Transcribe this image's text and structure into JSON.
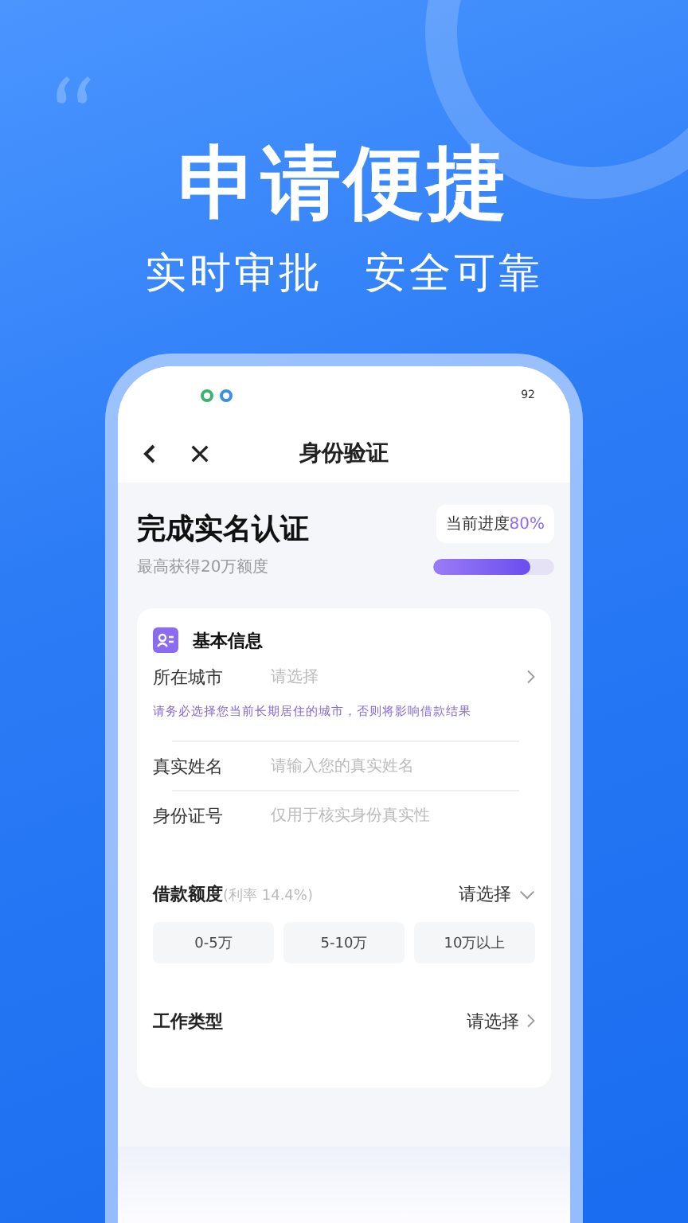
{
  "hero": {
    "title": "申请便捷",
    "subtitle": [
      "实时审批",
      "安全可靠"
    ]
  },
  "status_bar": {
    "battery": "92"
  },
  "nav": {
    "title": "身份验证"
  },
  "progress": {
    "heading": "完成实名认证",
    "subheading": "最高获得20万额度",
    "label": "当前进度",
    "percent": "80%",
    "level": 0.8
  },
  "basic_info": {
    "title": "基本信息",
    "fields": [
      {
        "kind": "select",
        "label": "所在城市",
        "placeholder": "请选择",
        "note": "请务必选择您当前长期居住的城市，否则将影响借款结果"
      },
      {
        "kind": "input",
        "label": "真实姓名",
        "placeholder": "请输入您的真实姓名"
      },
      {
        "kind": "input",
        "label": "身份证号",
        "placeholder": "仅用于核实身份真实性"
      }
    ]
  },
  "loan": {
    "label": "借款额度",
    "rate": "(利率 14.4%)",
    "value": "请选择",
    "options": [
      {
        "label": "0-5万",
        "selected": false
      },
      {
        "label": "5-10万",
        "selected": false
      },
      {
        "label": "10万以上",
        "selected": false
      }
    ]
  },
  "job": {
    "label": "工作类型",
    "value": "请选择"
  }
}
